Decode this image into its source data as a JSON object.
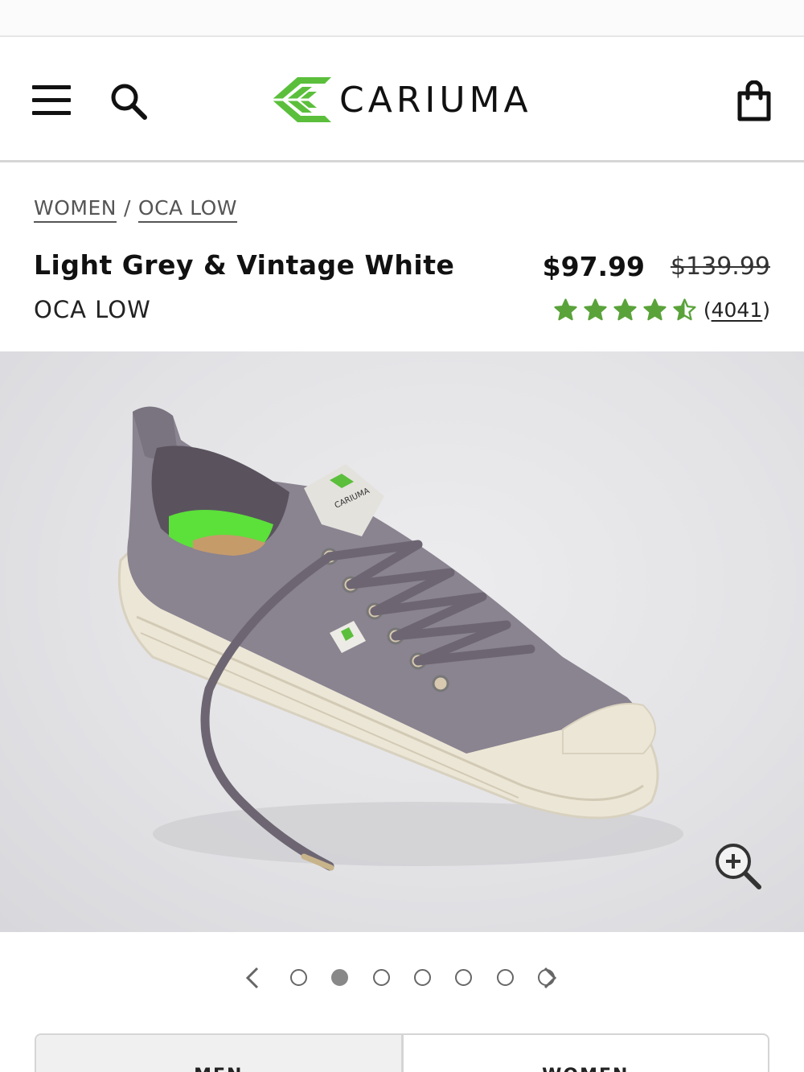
{
  "header": {
    "brand": "CARIUMA",
    "menu_icon": "hamburger-menu-icon",
    "search_icon": "search-icon",
    "bag_icon": "shopping-bag-icon",
    "brand_color": "#5bbf3c"
  },
  "breadcrumb": {
    "items": [
      "WOMEN",
      "OCA LOW"
    ],
    "separator": "/"
  },
  "product": {
    "title": "Light Grey & Vintage White",
    "subtitle": "OCA LOW",
    "price": "$97.99",
    "original_price": "$139.99",
    "rating": 4.5,
    "rating_max": 5,
    "review_count": "4041",
    "star_color": "#5aa33b"
  },
  "gallery": {
    "image_count": 7,
    "active_index": 1,
    "zoom_icon": "zoom-in-icon",
    "prev_icon": "chevron-left-icon",
    "next_icon": "chevron-right-icon"
  },
  "tabs": {
    "items": [
      "MEN",
      "WOMEN"
    ]
  }
}
